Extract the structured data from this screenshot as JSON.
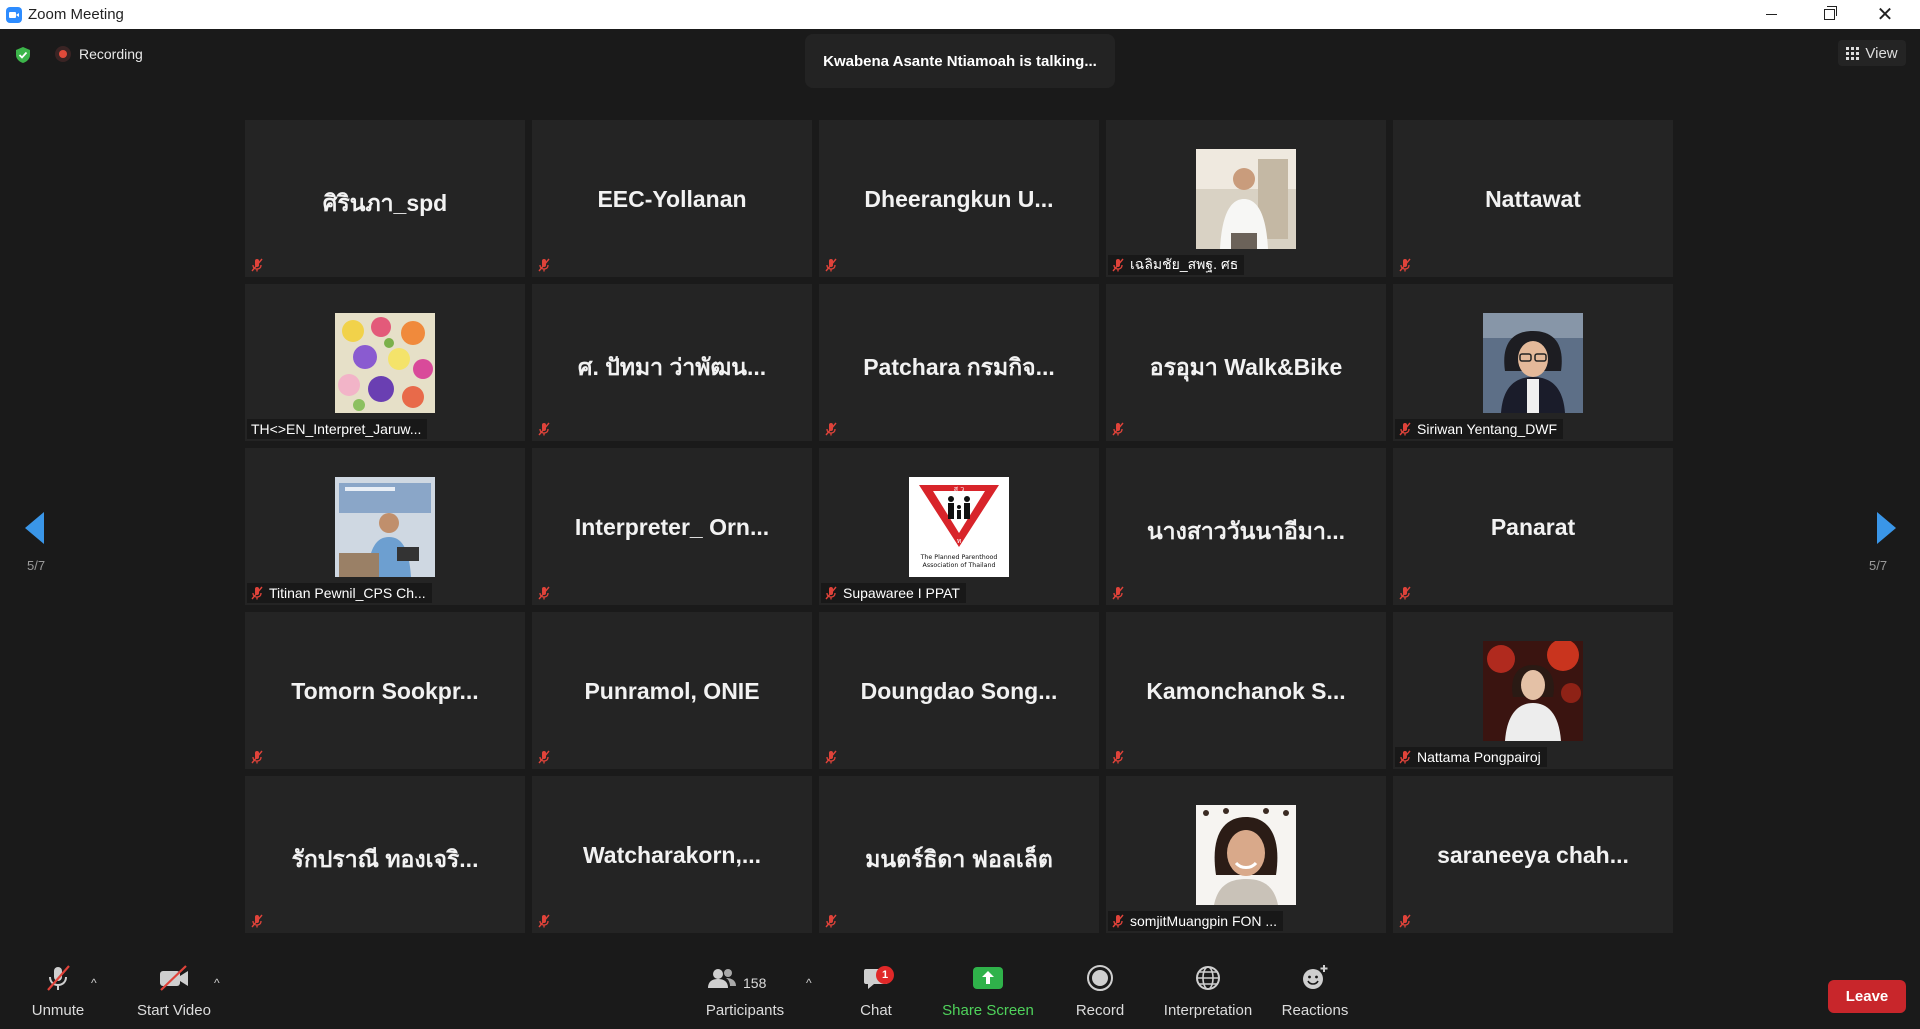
{
  "window": {
    "title": "Zoom Meeting"
  },
  "topbar": {
    "recording_label": "Recording",
    "talking": "Kwabena Asante Ntiamoah is talking...",
    "view_label": "View"
  },
  "pagination": {
    "left": "5/7",
    "right": "5/7"
  },
  "tiles": [
    {
      "name": "ศิรินภา_spd",
      "muted": true
    },
    {
      "name": "EEC-Yollanan",
      "muted": true
    },
    {
      "name": "Dheerangkun U...",
      "muted": true
    },
    {
      "name": "เฉลิมชัย_สพฐ. ศธ",
      "muted": true,
      "photo": "man-white-shirt"
    },
    {
      "name": "Nattawat",
      "muted": true
    },
    {
      "name": "TH<>EN_Interpret_Jaruw...",
      "muted": false,
      "photo": "flowers"
    },
    {
      "name": "ศ. ปัทมา ว่าพัฒน...",
      "muted": true
    },
    {
      "name": "Patchara กรมกิจ...",
      "muted": true
    },
    {
      "name": "อรอุมา Walk&Bike",
      "muted": true
    },
    {
      "name": "Siriwan Yentang_DWF",
      "muted": true,
      "photo": "woman-glasses"
    },
    {
      "name": "Titinan Pewnil_CPS Ch...",
      "muted": true,
      "photo": "man-presenting"
    },
    {
      "name": "Interpreter_ Orn...",
      "muted": true
    },
    {
      "name": "Supawaree I PPAT",
      "muted": true,
      "photo": "ppat-logo",
      "logo_text": "The Planned Parenthood Association of Thailand"
    },
    {
      "name": "นางสาววันนาอีมา...",
      "muted": true
    },
    {
      "name": "Panarat",
      "muted": true
    },
    {
      "name": "Tomorn Sookpr...",
      "muted": true
    },
    {
      "name": "Punramol, ONIE",
      "muted": true
    },
    {
      "name": "Doungdao Song...",
      "muted": true
    },
    {
      "name": "Kamonchanok S...",
      "muted": true
    },
    {
      "name": "Nattama Pongpairoj",
      "muted": true,
      "photo": "woman-red-bg"
    },
    {
      "name": "รักปราณี ทองเจริ...",
      "muted": true
    },
    {
      "name": "Watcharakorn,...",
      "muted": true
    },
    {
      "name": "มนตร์ธิดา ฟอลเล็ต",
      "muted": true
    },
    {
      "name": "somjitMuangpin FON ...",
      "muted": true,
      "photo": "woman-smiling"
    },
    {
      "name": "saraneeya chah...",
      "muted": true
    }
  ],
  "toolbar": {
    "unmute": "Unmute",
    "start_video": "Start Video",
    "participants": "Participants",
    "participants_count": "158",
    "chat": "Chat",
    "chat_badge": "1",
    "share_screen": "Share Screen",
    "record": "Record",
    "interpretation": "Interpretation",
    "reactions": "Reactions",
    "leave": "Leave"
  },
  "colors": {
    "accent_share": "#4fd25b",
    "leave": "#c8262b",
    "muted": "#e0433a",
    "tile_bg": "#242424"
  }
}
